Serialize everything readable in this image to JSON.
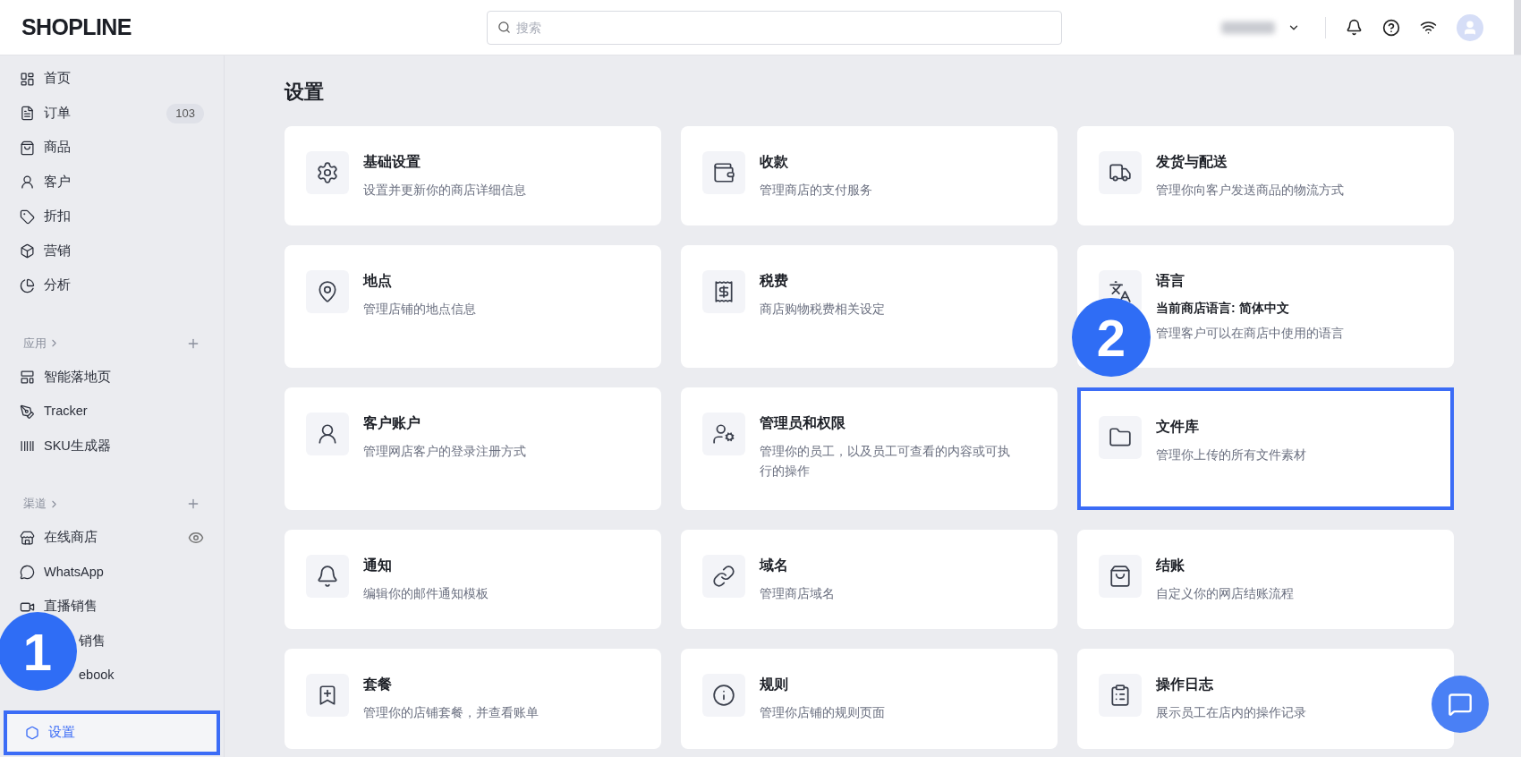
{
  "header": {
    "logo": "SHOPLINE",
    "search": {
      "placeholder": "搜索"
    }
  },
  "sidebar": {
    "items": [
      {
        "label": "首页",
        "selected": false
      },
      {
        "label": "订单",
        "badge": "103",
        "selected": false
      },
      {
        "label": "商品",
        "selected": false
      },
      {
        "label": "客户",
        "selected": false
      },
      {
        "label": "折扣",
        "selected": false
      },
      {
        "label": "营销",
        "selected": false
      },
      {
        "label": "分析",
        "selected": false
      }
    ],
    "groups": [
      {
        "title": "应用",
        "items": [
          {
            "label": "智能落地页",
            "selected": false
          },
          {
            "label": "Tracker",
            "selected": false
          },
          {
            "label": "SKU生成器",
            "selected": false
          }
        ]
      },
      {
        "title": "渠道",
        "items": [
          {
            "label": "在线商店",
            "selected": false
          },
          {
            "label": "WhatsApp",
            "selected": false
          },
          {
            "label": "直播销售",
            "selected": false
          },
          {
            "label": "销售",
            "selected": false,
            "kind": "partial"
          },
          {
            "label": "ebook",
            "selected": false,
            "kind": "partial"
          }
        ]
      }
    ],
    "settings": {
      "label": "设置",
      "selected": true
    }
  },
  "page": {
    "title": "设置",
    "cards": [
      {
        "title": "基础设置",
        "description": "设置并更新你的商店详细信息",
        "highlighted": false
      },
      {
        "title": "收款",
        "description": "管理商店的支付服务",
        "highlighted": false
      },
      {
        "title": "发货与配送",
        "description": "管理你向客户发送商品的物流方式",
        "highlighted": false
      },
      {
        "title": "地点",
        "description": "管理店铺的地点信息",
        "highlighted": false
      },
      {
        "title": "税费",
        "description": "商店购物税费相关设定",
        "highlighted": false
      },
      {
        "title": "语言",
        "status": "当前商店语言: 简体中文",
        "description": "管理客户可以在商店中使用的语言",
        "highlighted": false
      },
      {
        "title": "客户账户",
        "description": "管理网店客户的登录注册方式",
        "highlighted": false
      },
      {
        "title": "管理员和权限",
        "description": "管理你的员工，以及员工可查看的内容或可执行的操作",
        "highlighted": false
      },
      {
        "title": "文件库",
        "description": "管理你上传的所有文件素材",
        "highlighted": true
      },
      {
        "title": "通知",
        "description": "编辑你的邮件通知模板",
        "highlighted": false
      },
      {
        "title": "域名",
        "description": "管理商店域名",
        "highlighted": false
      },
      {
        "title": "结账",
        "description": "自定义你的网店结账流程",
        "highlighted": false
      },
      {
        "title": "套餐",
        "description": "管理你的店铺套餐，并查看账单",
        "highlighted": false
      },
      {
        "title": "规则",
        "description": "管理你店铺的规则页面",
        "highlighted": false
      },
      {
        "title": "操作日志",
        "description": "展示员工在店内的操作记录",
        "highlighted": false
      }
    ]
  },
  "step_markers": [
    {
      "number": "1"
    },
    {
      "number": "2"
    }
  ]
}
